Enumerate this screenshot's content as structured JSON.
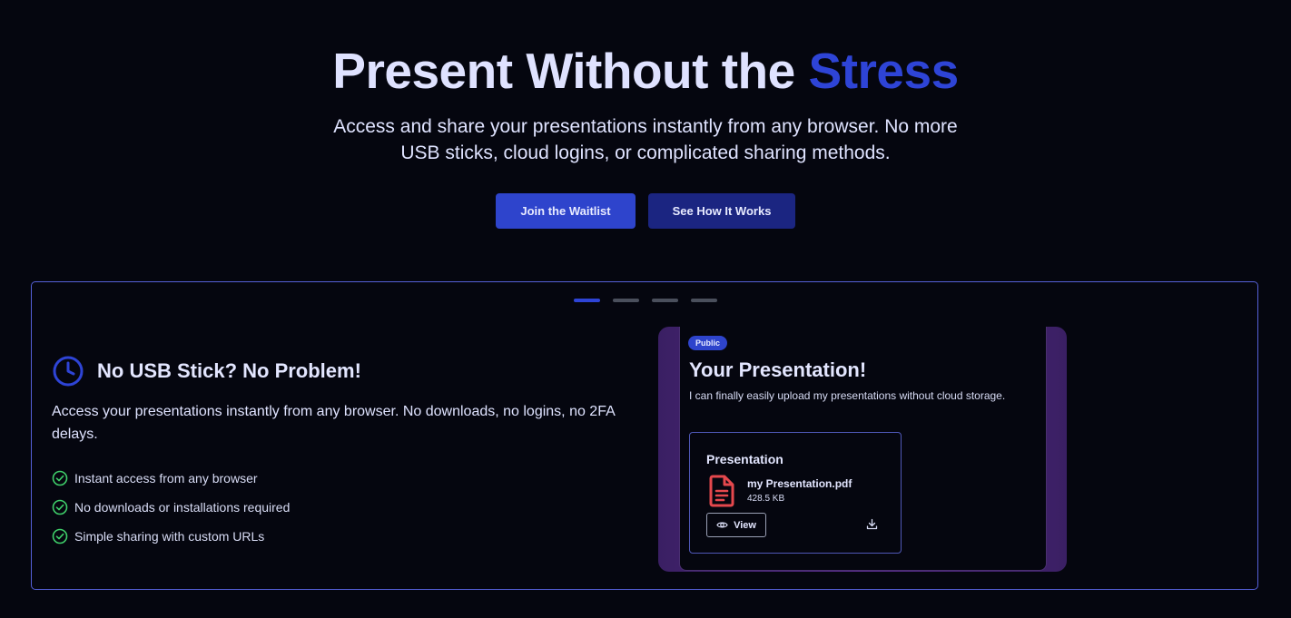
{
  "hero": {
    "title_main": "Present Without the ",
    "title_accent": "Stress",
    "subtitle": "Access and share your presentations instantly from any browser. No more USB sticks, cloud logins, or complicated sharing methods.",
    "primary_button": "Join the Waitlist",
    "secondary_button": "See How It Works"
  },
  "carousel": {
    "slide_count": 4,
    "active_index": 0
  },
  "feature": {
    "icon": "clock-icon",
    "title": "No USB Stick? No Problem!",
    "description": "Access your presentations instantly from any browser. No downloads, no logins, no 2FA delays.",
    "bullets": [
      "Instant access from any browser",
      "No downloads or installations required",
      "Simple sharing with custom URLs"
    ]
  },
  "preview": {
    "badge": "Public",
    "title": "Your Presentation!",
    "description": "I can finally easily upload my presentations without cloud storage.",
    "file_card": {
      "title": "Presentation",
      "file_name": "my Presentation.pdf",
      "file_size": "428.5 KB",
      "view_label": "View"
    }
  },
  "colors": {
    "background": "#05060f",
    "accent": "#2e44d6",
    "primary_button": "#2e44cc",
    "secondary_button": "#1b2581",
    "check_green": "#3fcf6a",
    "pdf_red": "#e5484d",
    "panel_border": "#5560d8"
  }
}
